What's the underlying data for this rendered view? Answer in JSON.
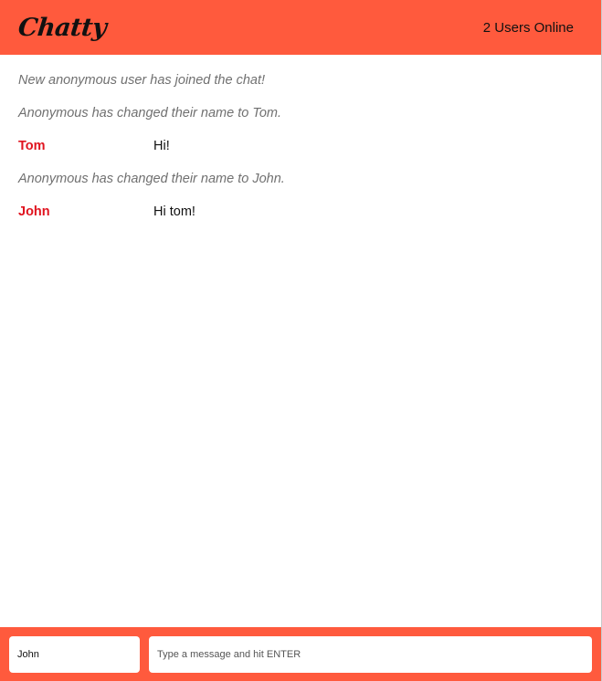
{
  "navbar": {
    "brand": "Chatty",
    "online_count": "2 Users Online"
  },
  "messages": [
    {
      "type": "system",
      "content": "New anonymous user has joined the chat!"
    },
    {
      "type": "system",
      "content": "Anonymous has changed their name to Tom."
    },
    {
      "type": "chat",
      "username": "Tom",
      "content": "Hi!"
    },
    {
      "type": "system",
      "content": "Anonymous has changed their name to John."
    },
    {
      "type": "chat",
      "username": "John",
      "content": "Hi tom!"
    }
  ],
  "chatbar": {
    "username_value": "John",
    "message_placeholder": "Type a message and hit ENTER",
    "message_value": ""
  },
  "colors": {
    "accent": "#ff5a3d",
    "username": "#e0141f",
    "system_text": "#707070"
  }
}
